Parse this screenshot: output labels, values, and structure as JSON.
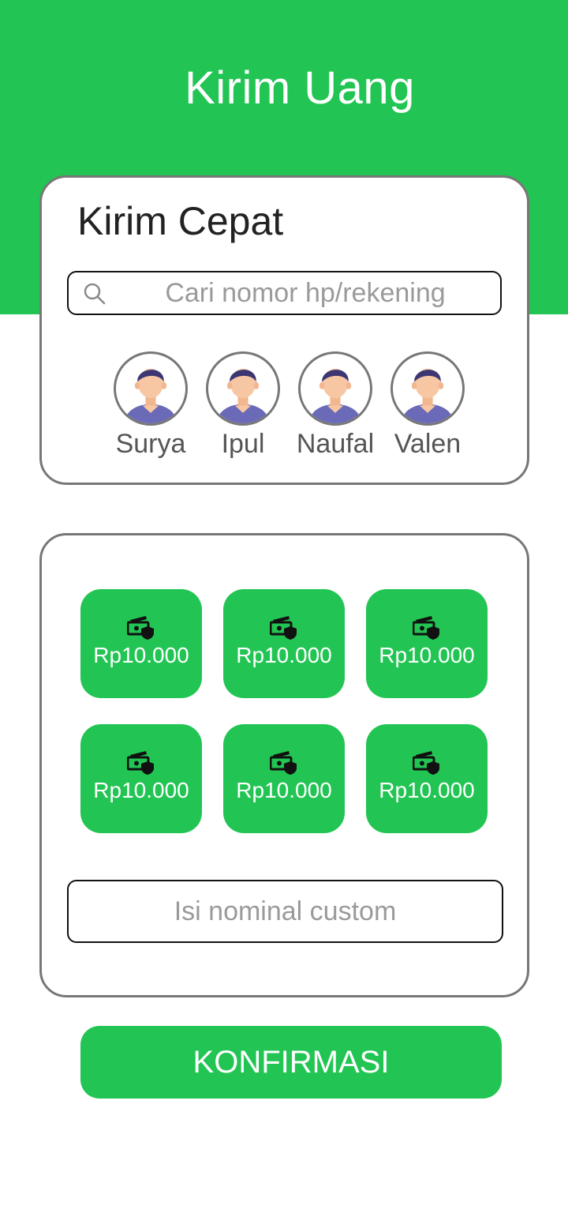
{
  "app": {
    "title": "Kirim Uang",
    "accent_color": "#22c553"
  },
  "quick_send": {
    "title": "Kirim Cepat",
    "search": {
      "placeholder": "Cari nomor hp/rekening",
      "value": "",
      "icon": "search-icon"
    },
    "contacts": [
      {
        "name": "Surya",
        "icon": "avatar-icon"
      },
      {
        "name": "Ipul",
        "icon": "avatar-icon"
      },
      {
        "name": "Naufal",
        "icon": "avatar-icon"
      },
      {
        "name": "Valen",
        "icon": "avatar-icon"
      }
    ]
  },
  "amounts": {
    "icon": "money-shield-icon",
    "options": [
      {
        "label": "Rp10.000"
      },
      {
        "label": "Rp10.000"
      },
      {
        "label": "Rp10.000"
      },
      {
        "label": "Rp10.000"
      },
      {
        "label": "Rp10.000"
      },
      {
        "label": "Rp10.000"
      }
    ],
    "custom": {
      "placeholder": "Isi nominal custom",
      "value": ""
    }
  },
  "actions": {
    "confirm_label": "KONFIRMASI"
  }
}
